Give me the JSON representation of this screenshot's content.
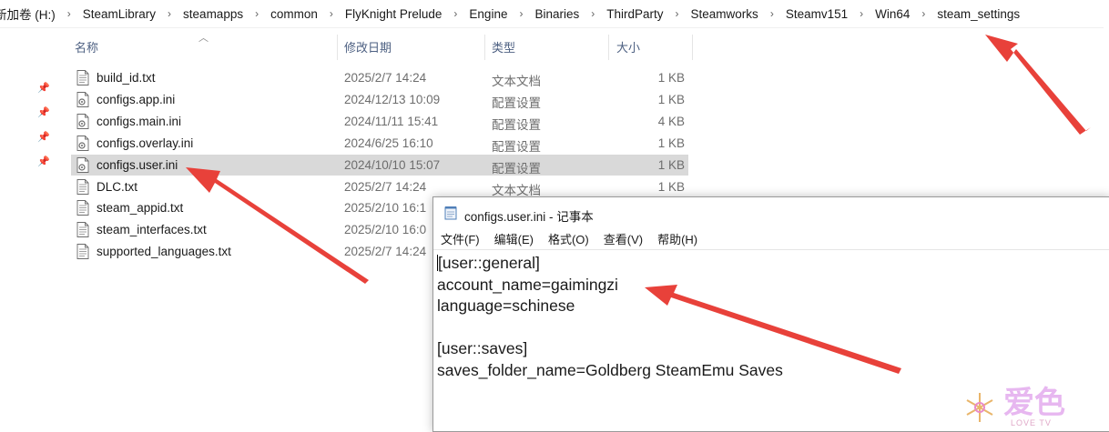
{
  "breadcrumb": [
    "新加卷 (H:)",
    "SteamLibrary",
    "steamapps",
    "common",
    "FlyKnight Prelude",
    "Engine",
    "Binaries",
    "ThirdParty",
    "Steamworks",
    "Steamv151",
    "Win64",
    "steam_settings"
  ],
  "columns": {
    "name": "名称",
    "date": "修改日期",
    "type": "类型",
    "size": "大小"
  },
  "files": [
    {
      "name": "build_id.txt",
      "date": "2025/2/7 14:24",
      "type": "文本文档",
      "size": "1 KB",
      "icon": "text-file-icon"
    },
    {
      "name": "configs.app.ini",
      "date": "2024/12/13 10:09",
      "type": "配置设置",
      "size": "1 KB",
      "icon": "ini-file-icon"
    },
    {
      "name": "configs.main.ini",
      "date": "2024/11/11 15:41",
      "type": "配置设置",
      "size": "4 KB",
      "icon": "ini-file-icon"
    },
    {
      "name": "configs.overlay.ini",
      "date": "2024/6/25 16:10",
      "type": "配置设置",
      "size": "1 KB",
      "icon": "ini-file-icon"
    },
    {
      "name": "configs.user.ini",
      "date": "2024/10/10 15:07",
      "type": "配置设置",
      "size": "1 KB",
      "icon": "ini-file-icon",
      "selected": true
    },
    {
      "name": "DLC.txt",
      "date": "2025/2/7 14:24",
      "type": "文本文档",
      "size": "1 KB",
      "icon": "text-file-icon"
    },
    {
      "name": "steam_appid.txt",
      "date": "2025/2/10 16:1",
      "type": "",
      "size": "",
      "icon": "text-file-icon"
    },
    {
      "name": "steam_interfaces.txt",
      "date": "2025/2/10 16:0",
      "type": "",
      "size": "",
      "icon": "text-file-icon"
    },
    {
      "name": "supported_languages.txt",
      "date": "2025/2/7 14:24",
      "type": "",
      "size": "",
      "icon": "text-file-icon"
    }
  ],
  "notepad": {
    "title": "configs.user.ini - 记事本",
    "menu": [
      "文件(F)",
      "编辑(E)",
      "格式(O)",
      "查看(V)",
      "帮助(H)"
    ],
    "lines": [
      "[user::general]",
      "account_name=gaimingzi",
      "language=schinese",
      "",
      "[user::saves]",
      "saves_folder_name=Goldberg SteamEmu Saves"
    ]
  },
  "watermark": {
    "text": "爱色",
    "sub": "LOVE TV"
  },
  "colors": {
    "selected_row": "#d9d9d9",
    "arrow": "#e8413a",
    "header_text": "#4d6082"
  }
}
